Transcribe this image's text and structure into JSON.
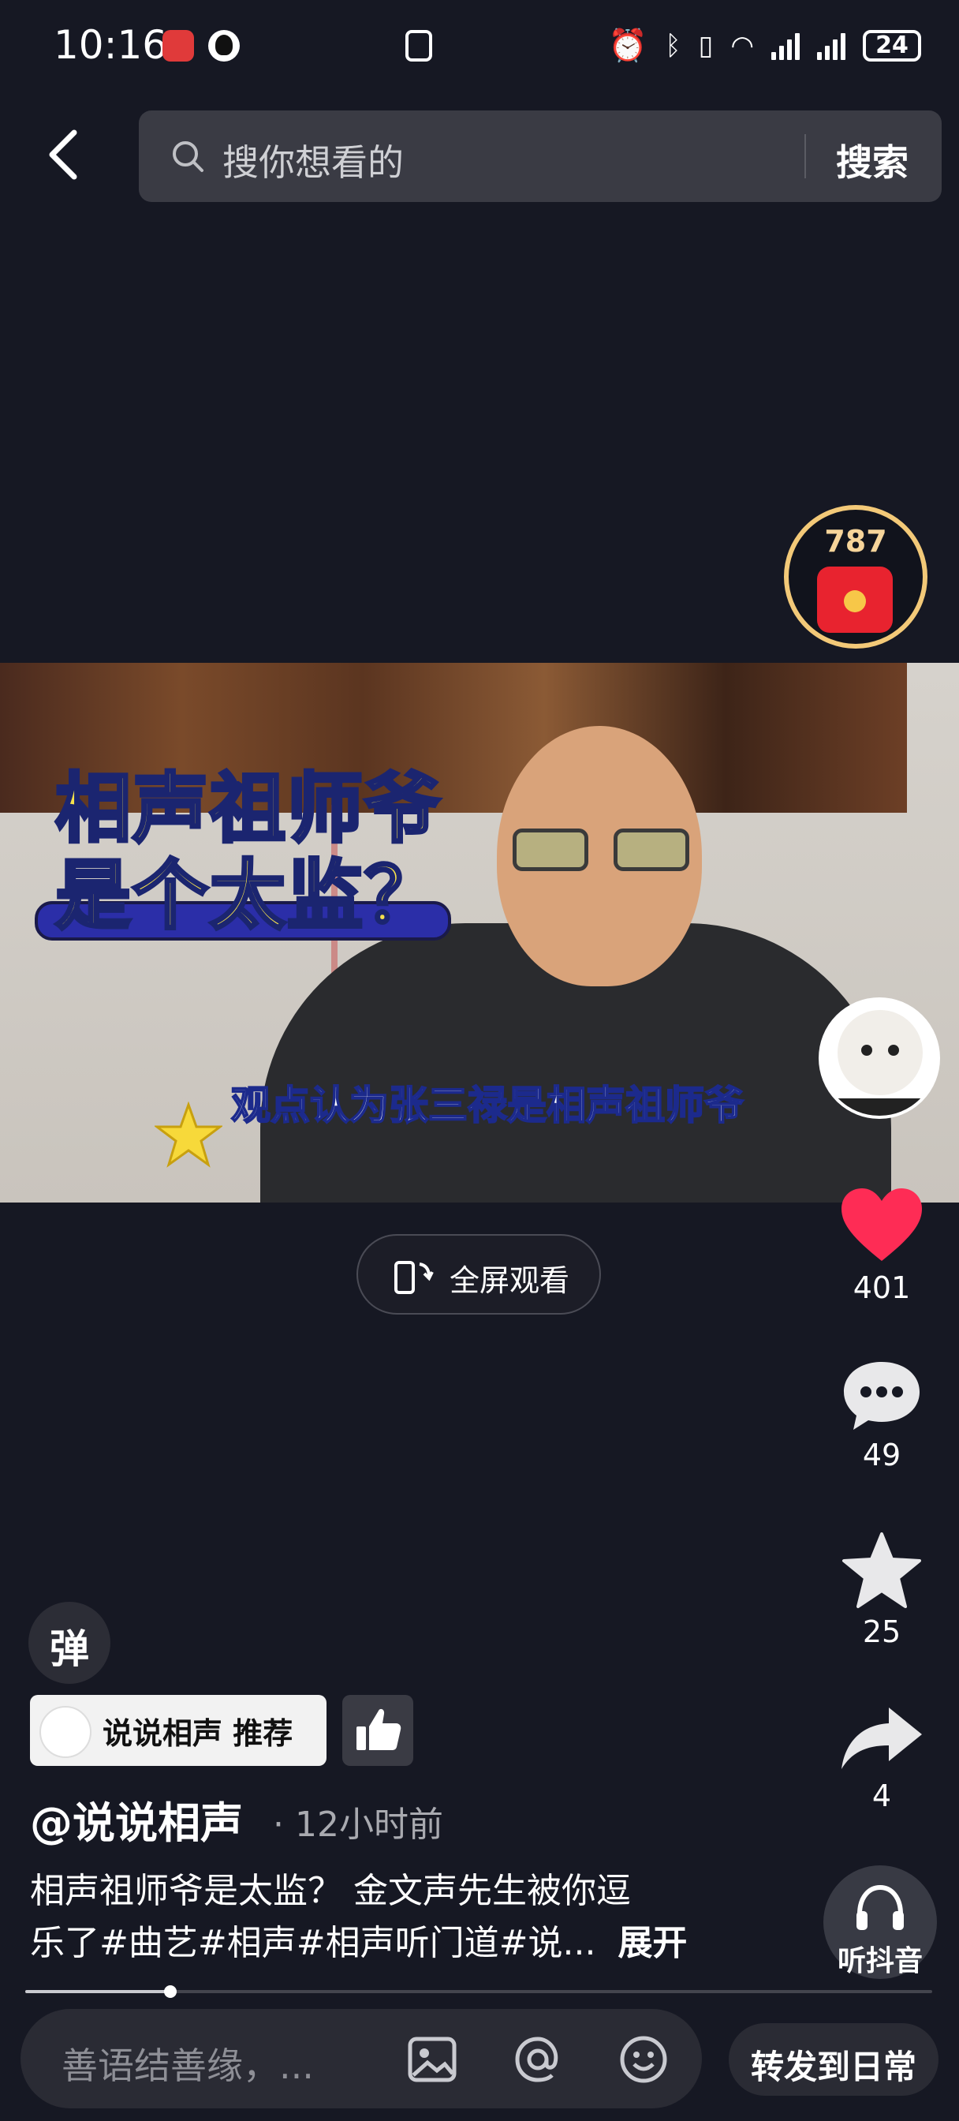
{
  "status_bar": {
    "time": "10:16",
    "battery": "24"
  },
  "search": {
    "placeholder": "搜你想看的",
    "button": "搜索"
  },
  "red_packet": {
    "count": "787"
  },
  "video": {
    "title_overlay_line1": "相声祖师爷",
    "title_overlay_line2": "是个太监？",
    "subtitle": "观点认为张三禄是相声祖师爷"
  },
  "fullscreen": {
    "label": "全屏观看"
  },
  "actions": {
    "likes": "401",
    "comments": "49",
    "favorites": "25",
    "shares": "4"
  },
  "danmaku": {
    "label": "弹"
  },
  "recommend_tag": {
    "label": "说说相声 推荐"
  },
  "post": {
    "author": "@说说相声",
    "time": "· 12小时前",
    "description_line1": "相声祖师爷是太监？ 金文声先生被你逗",
    "description_line2": "乐了#曲艺#相声#相声听门道#说...",
    "expand": "展开"
  },
  "listen": {
    "label": "听抖音"
  },
  "playback": {
    "progress": 0.16
  },
  "comment_bar": {
    "placeholder": "善语结善缘，...",
    "repost": "转发到日常"
  },
  "colors": {
    "like": "#fe2c55",
    "background": "#161823",
    "title_yellow": "#f6e24c"
  }
}
